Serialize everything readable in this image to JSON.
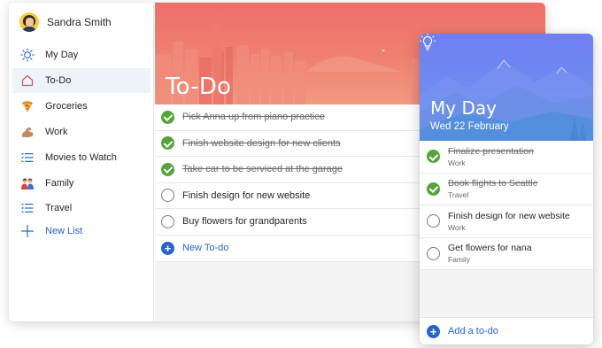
{
  "user": {
    "name": "Sandra Smith"
  },
  "sidebar": {
    "items": [
      {
        "label": "My Day",
        "icon": "sun-icon"
      },
      {
        "label": "To-Do",
        "icon": "house-icon"
      },
      {
        "label": "Groceries",
        "icon": "pizza-emoji-icon"
      },
      {
        "label": "Work",
        "icon": "flexed-arm-emoji-icon"
      },
      {
        "label": "Movies to Watch",
        "icon": "list-icon"
      },
      {
        "label": "Family",
        "icon": "family-emoji-icon"
      },
      {
        "label": "Travel",
        "icon": "list-icon"
      }
    ],
    "new_list_label": "New List"
  },
  "list": {
    "title": "To-Do",
    "tasks": [
      {
        "text": "Pick Anna up from piano practice",
        "done": true
      },
      {
        "text": "Finish website design for new clients",
        "done": true
      },
      {
        "text": "Take car to be serviced at the garage",
        "done": true
      },
      {
        "text": "Finish design for new website",
        "done": false
      },
      {
        "text": "Buy flowers for grandparents",
        "done": false
      }
    ],
    "add_label": "New To-do"
  },
  "myday": {
    "title": "My Day",
    "date": "Wed 22 February",
    "tasks": [
      {
        "title": "Finalize presentation",
        "list": "Work",
        "done": true
      },
      {
        "title": "Book flights to Seattle",
        "list": "Travel",
        "done": true
      },
      {
        "title": "Finish design for new website",
        "list": "Work",
        "done": false
      },
      {
        "title": "Get flowers for nana",
        "list": "Family",
        "done": false
      }
    ],
    "add_label": "Add a to-do"
  },
  "colors": {
    "accent": "#2564cf",
    "done_check": "#55a33a",
    "todo_header": "#ee6f6a",
    "myday_header": "#6f7ef2"
  }
}
